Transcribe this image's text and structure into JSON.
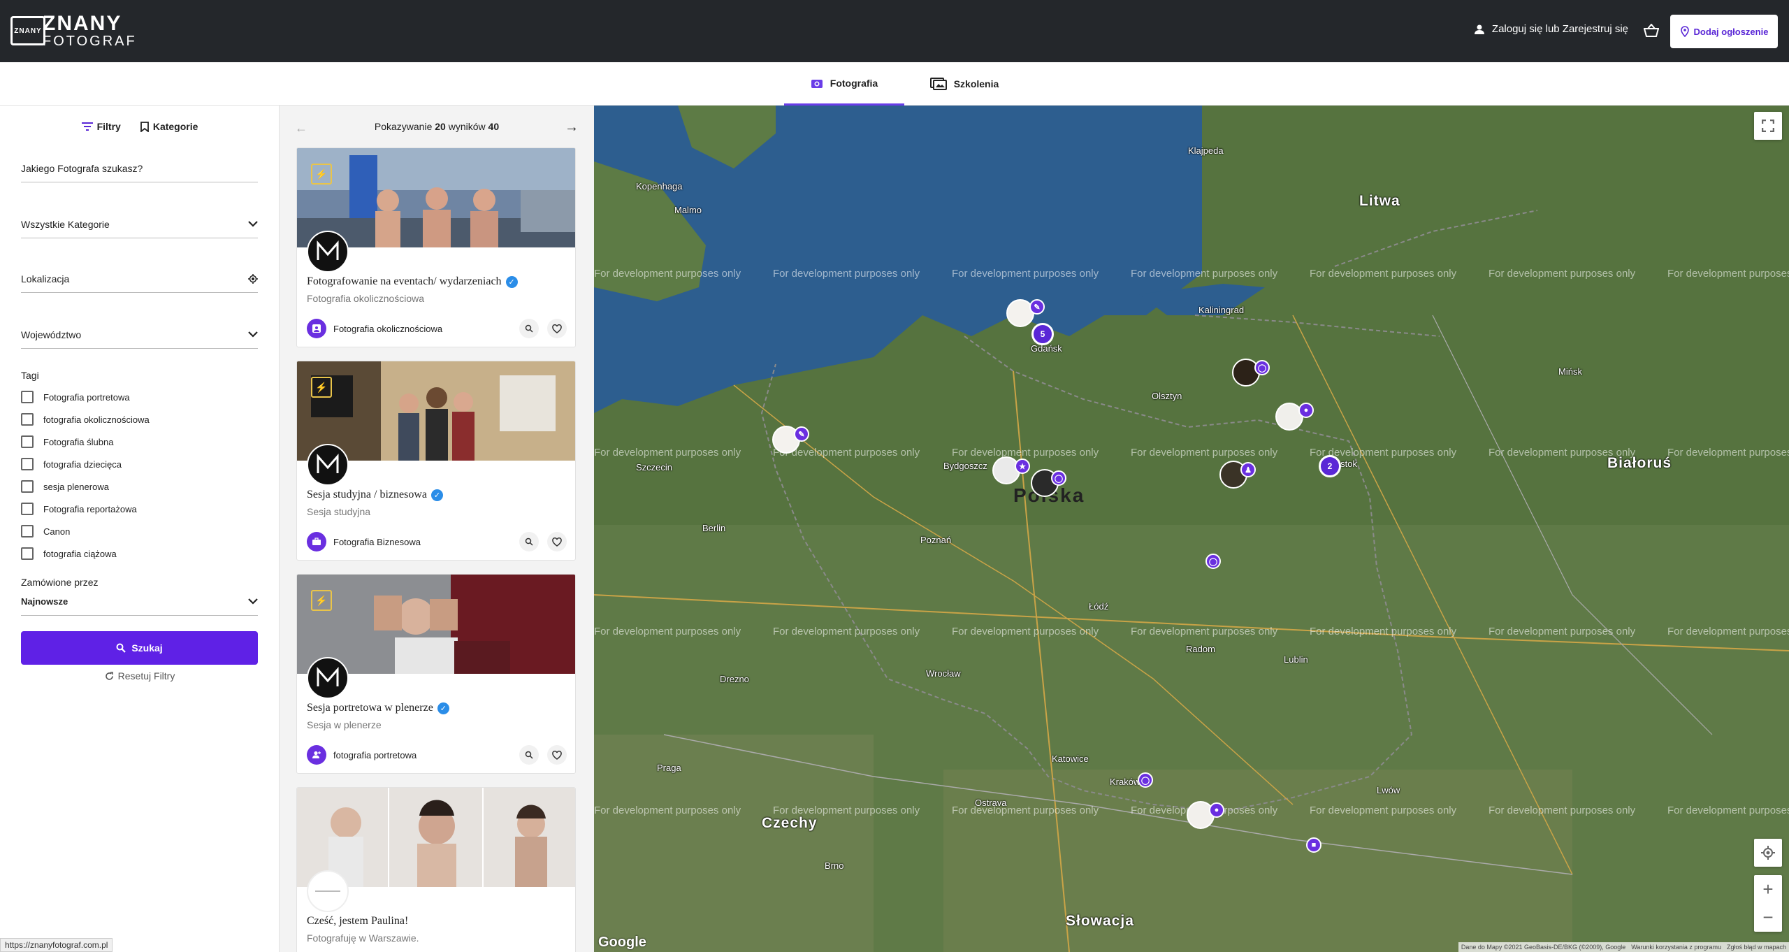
{
  "header": {
    "logo_line1": "ZNANY",
    "logo_line2": "FOTOGRAF",
    "logo_mark": "ZNANY",
    "login_label": "Zaloguj się lub Zarejestruj się",
    "add_button": "Dodaj ogłoszenie"
  },
  "tabs": [
    {
      "label": "Fotografia",
      "active": true
    },
    {
      "label": "Szkolenia",
      "active": false
    }
  ],
  "sidebar": {
    "filters_label": "Filtry",
    "categories_label": "Kategorie",
    "search_field": "Jakiego Fotografa szukasz?",
    "category_select": "Wszystkie Kategorie",
    "location_field": "Lokalizacja",
    "voivodeship_select": "Województwo",
    "tags_title": "Tagi",
    "tags": [
      "Fotografia portretowa",
      "fotografia okolicznościowa",
      "Fotografia ślubna",
      "fotografia dziecięca",
      "sesja plenerowa",
      "Fotografia reportażowa",
      "Canon",
      "fotografia ciążowa"
    ],
    "order_label": "Zamówione przez",
    "order_value": "Najnowsze",
    "search_button": "Szukaj",
    "reset_label": "Resetuj Filtry"
  },
  "results": {
    "showing_prefix": "Pokazywanie",
    "showing_count": "20",
    "showing_mid": "wyników",
    "total": "40",
    "cards": [
      {
        "title": "Fotografowanie na eventach/ wydarzeniach",
        "subtitle": "Fotografia okolicznościowa",
        "category": "Fotografia okolicznościowa",
        "verified": true
      },
      {
        "title": "Sesja studyjna / biznesowa",
        "subtitle": "Sesja studyjna",
        "category": "Fotografia Biznesowa",
        "verified": true
      },
      {
        "title": "Sesja portretowa w plenerze",
        "subtitle": "Sesja w plenerze",
        "category": "fotografia portretowa",
        "verified": true
      },
      {
        "title": "Cześć, jestem Paulina!",
        "subtitle": "Fotografuję w Warszawie.",
        "category": "",
        "verified": false
      }
    ]
  },
  "map": {
    "dev_text": "For development purposes only",
    "labels": {
      "litwa": "Litwa",
      "polska": "Polska",
      "bialorus": "Białoruś",
      "czechy": "Czechy",
      "slowacja": "Słowacja",
      "kopenhaga": "Kopenhaga",
      "malmo": "Malmo",
      "klajpeda": "Klajpeda",
      "gdansk": "Gdańsk",
      "olsztyn": "Olsztyn",
      "bydgoszcz": "Bydgoszcz",
      "poznan": "Poznań",
      "berlin": "Berlin",
      "lodz": "Łódź",
      "lublin": "Lublin",
      "katowice": "Katowice",
      "krakow": "Kraków",
      "wroclaw": "Wrocław",
      "radom": "Radom",
      "bialystok": "Białystok",
      "minsk": "Mińsk",
      "lwow": "Lwów",
      "szczecin": "Szczecin",
      "kaliningrad": "Kaliningrad",
      "drezno": "Drezno",
      "praga": "Praga",
      "brno": "Brno",
      "ostrava": "Ostrava"
    },
    "clusters": [
      "5",
      "2"
    ],
    "attribution": "Dane do Mapy ©2021 GeoBasis-DE/BKG (©2009), Google",
    "terms": "Warunki korzystania z programu",
    "report": "Zgłoś błąd w mapach",
    "google": "Google"
  },
  "status_url": "https://znanyfotograf.com.pl",
  "colors": {
    "accent": "#5f21e6",
    "header_bg": "#24272b",
    "verified": "#2a8de8"
  }
}
